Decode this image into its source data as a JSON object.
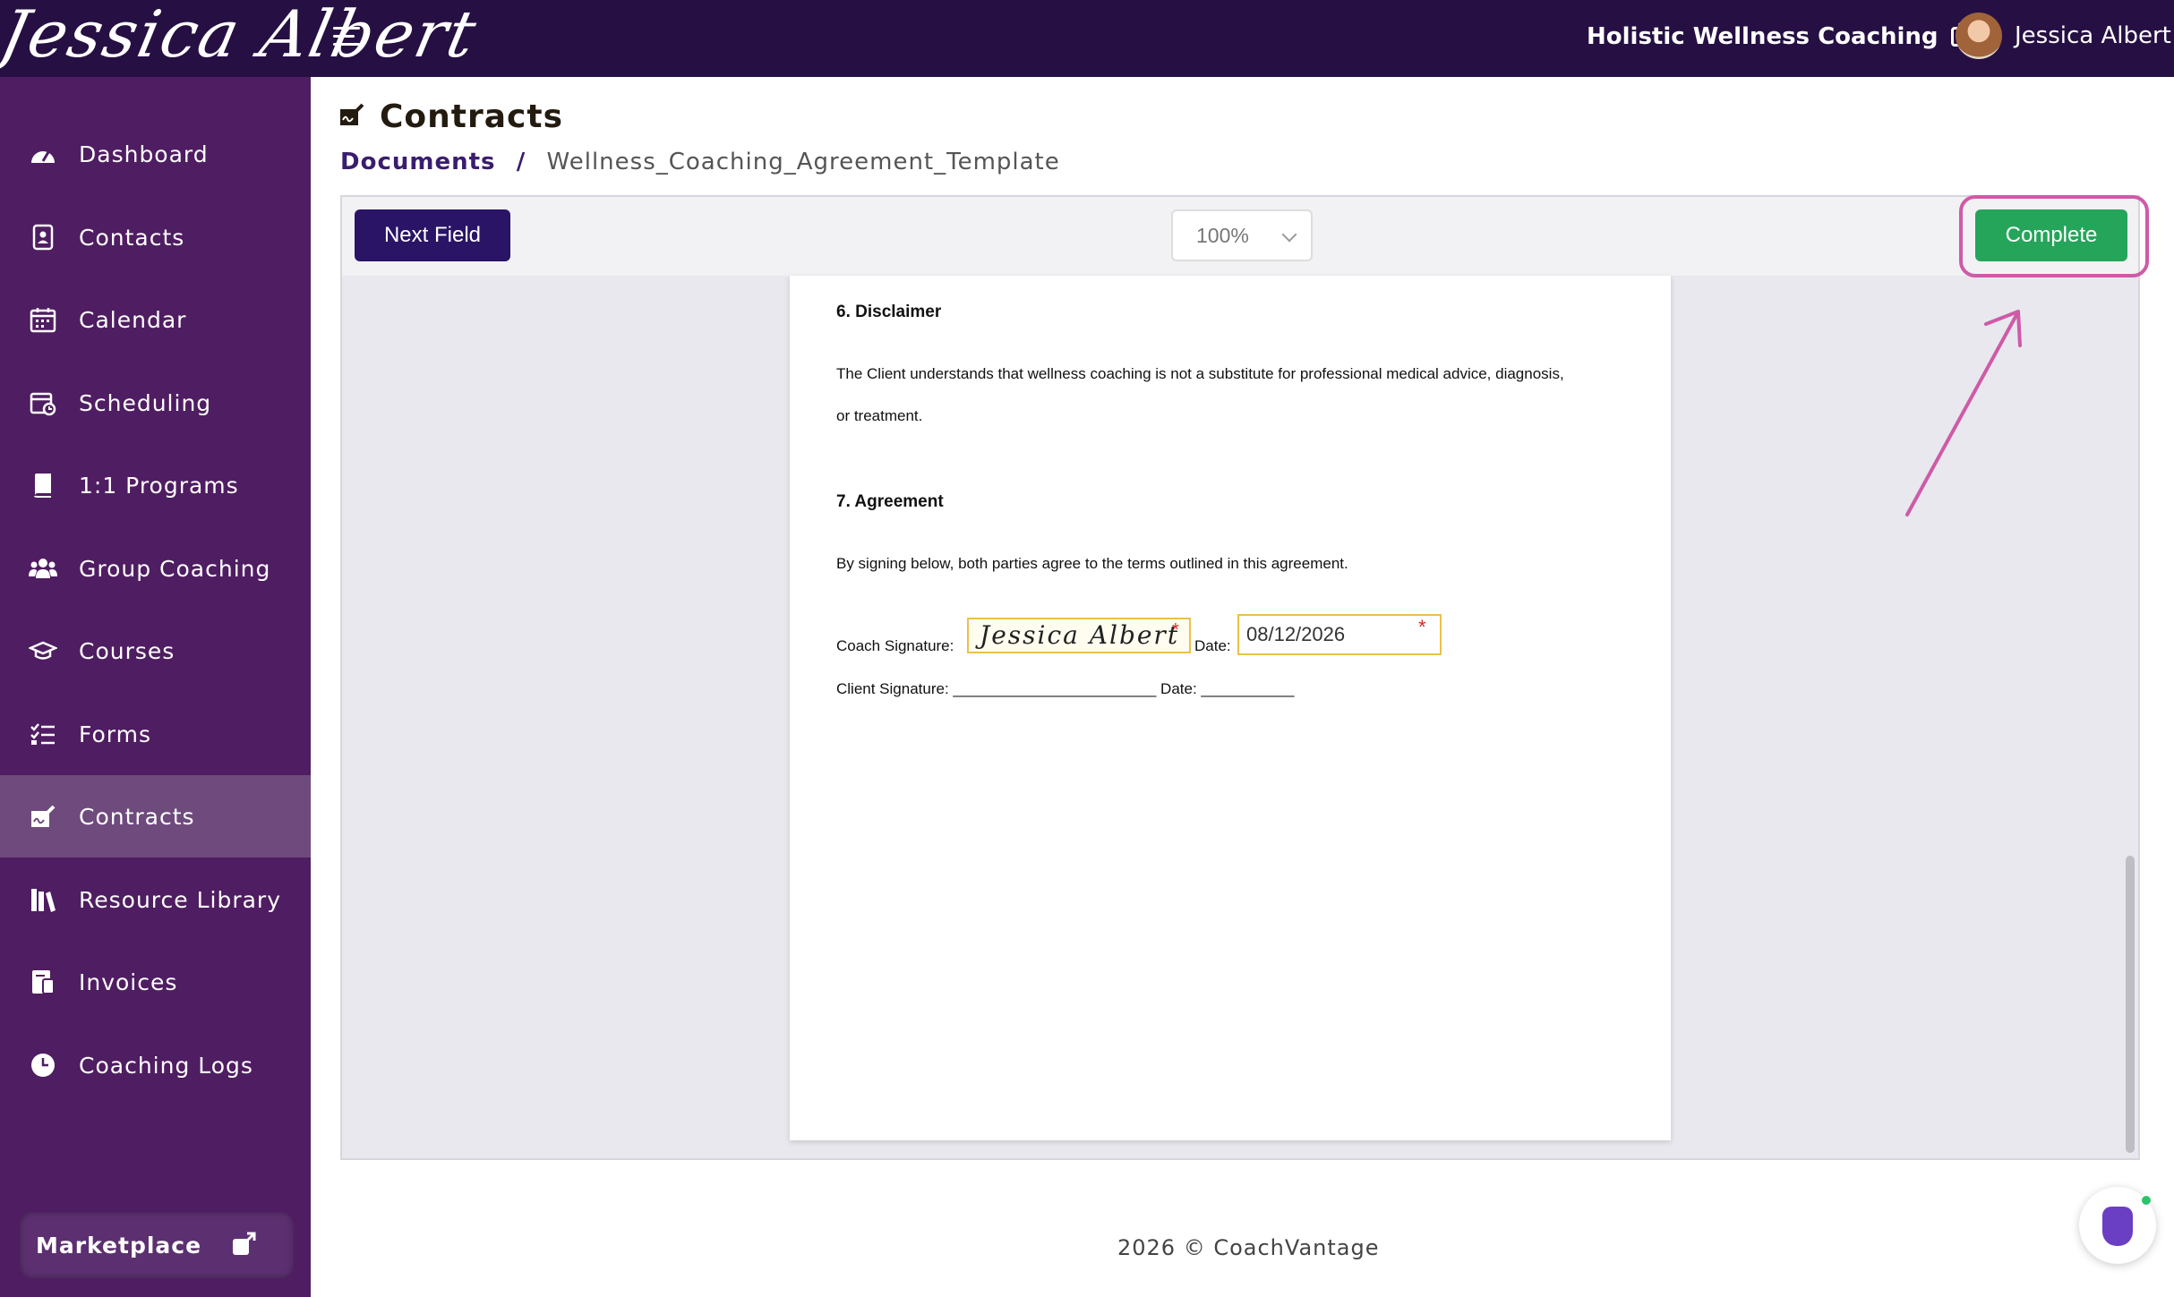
{
  "header": {
    "logo_text": "Jessica Albert",
    "business_name": "Holistic Wellness Coaching",
    "user_name": "Jessica Albert"
  },
  "sidebar": {
    "items": [
      {
        "label": "Dashboard",
        "icon": "dashboard-icon"
      },
      {
        "label": "Contacts",
        "icon": "contacts-icon"
      },
      {
        "label": "Calendar",
        "icon": "calendar-icon"
      },
      {
        "label": "Scheduling",
        "icon": "scheduling-icon"
      },
      {
        "label": "1:1 Programs",
        "icon": "book-icon"
      },
      {
        "label": "Group Coaching",
        "icon": "group-icon"
      },
      {
        "label": "Courses",
        "icon": "graduation-cap-icon"
      },
      {
        "label": "Forms",
        "icon": "list-icon"
      },
      {
        "label": "Contracts",
        "icon": "signature-icon",
        "active": true
      },
      {
        "label": "Resource Library",
        "icon": "library-icon"
      },
      {
        "label": "Invoices",
        "icon": "invoice-icon"
      },
      {
        "label": "Coaching Logs",
        "icon": "clock-icon"
      }
    ],
    "marketplace_label": "Marketplace"
  },
  "page": {
    "title": "Contracts",
    "breadcrumb_root": "Documents",
    "breadcrumb_sep": "/",
    "breadcrumb_current": "Wellness_Coaching_Agreement_Template"
  },
  "toolbar": {
    "next_field_label": "Next Field",
    "zoom_value": "100%",
    "complete_label": "Complete"
  },
  "document": {
    "section6_heading": "6. Disclaimer",
    "section6_text_line1": "The Client understands that wellness coaching is not a substitute for professional medical advice, diagnosis,",
    "section6_text_line2": "or treatment.",
    "section7_heading": "7. Agreement",
    "section7_text": "By signing below, both parties agree to the terms outlined in this agreement.",
    "coach_signature_label": "Coach Signature:",
    "coach_signature_value": "Jessica Albert",
    "date_label": "Date:",
    "coach_date_value": "08/12/2026",
    "required_marker": "*",
    "client_signature_line": "Client Signature: ________________________ Date: ___________"
  },
  "footer": {
    "copyright": "2026 © CoachVantage"
  },
  "colors": {
    "topbar": "#261043",
    "sidebar": "#4f1d61",
    "sidebar_active": "#6e4a7d",
    "primary_button": "#2a1466",
    "complete_button": "#25a55a",
    "annotation": "#cf5aa8"
  }
}
